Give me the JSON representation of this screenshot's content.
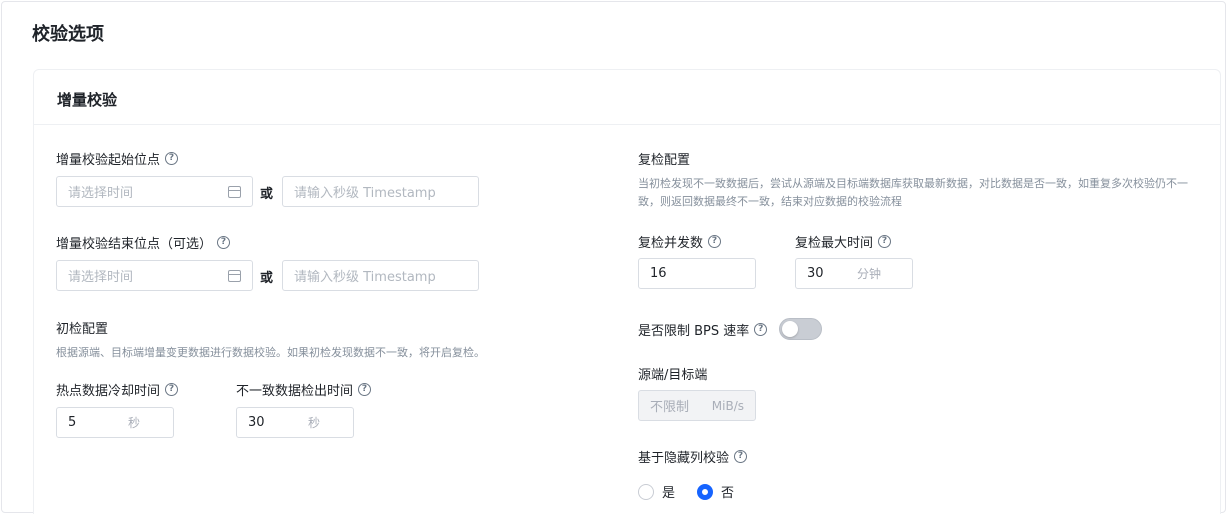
{
  "page": {
    "title": "校验选项"
  },
  "card": {
    "title": "增量校验"
  },
  "left": {
    "start": {
      "label": "增量校验起始位点",
      "time_placeholder": "请选择时间",
      "or": "或",
      "ts_placeholder": "请输入秒级 Timestamp"
    },
    "end": {
      "label": "增量校验结束位点（可选）",
      "time_placeholder": "请选择时间",
      "or": "或",
      "ts_placeholder": "请输入秒级 Timestamp"
    },
    "initial": {
      "title": "初检配置",
      "desc": "根据源端、目标端增量变更数据进行数据校验。如果初检发现数据不一致，将开启复检。"
    },
    "hot_cooldown": {
      "label": "热点数据冷却时间",
      "value": "5",
      "unit": "秒"
    },
    "inconsistent_time": {
      "label": "不一致数据检出时间",
      "value": "30",
      "unit": "秒"
    }
  },
  "right": {
    "recheck": {
      "title": "复检配置",
      "desc": "当初检发现不一致数据后，尝试从源端及目标端数据库获取最新数据，对比数据是否一致，如重复多次校验仍不一致，则返回数据最终不一致，结束对应数据的校验流程"
    },
    "concurrency": {
      "label": "复检并发数",
      "value": "16"
    },
    "max_time": {
      "label": "复检最大时间",
      "value": "30",
      "unit": "分钟"
    },
    "bps_limit": {
      "label": "是否限制 BPS 速率",
      "enabled": false
    },
    "src_dst": {
      "label": "源端/目标端",
      "value": "不限制",
      "unit": "MiB/s"
    },
    "hidden_col": {
      "label": "基于隐藏列校验",
      "options": [
        "是",
        "否"
      ],
      "selected": "否"
    }
  },
  "colors": {
    "accent": "#1664ff",
    "border": "#d9dde3",
    "muted": "#86909c"
  }
}
